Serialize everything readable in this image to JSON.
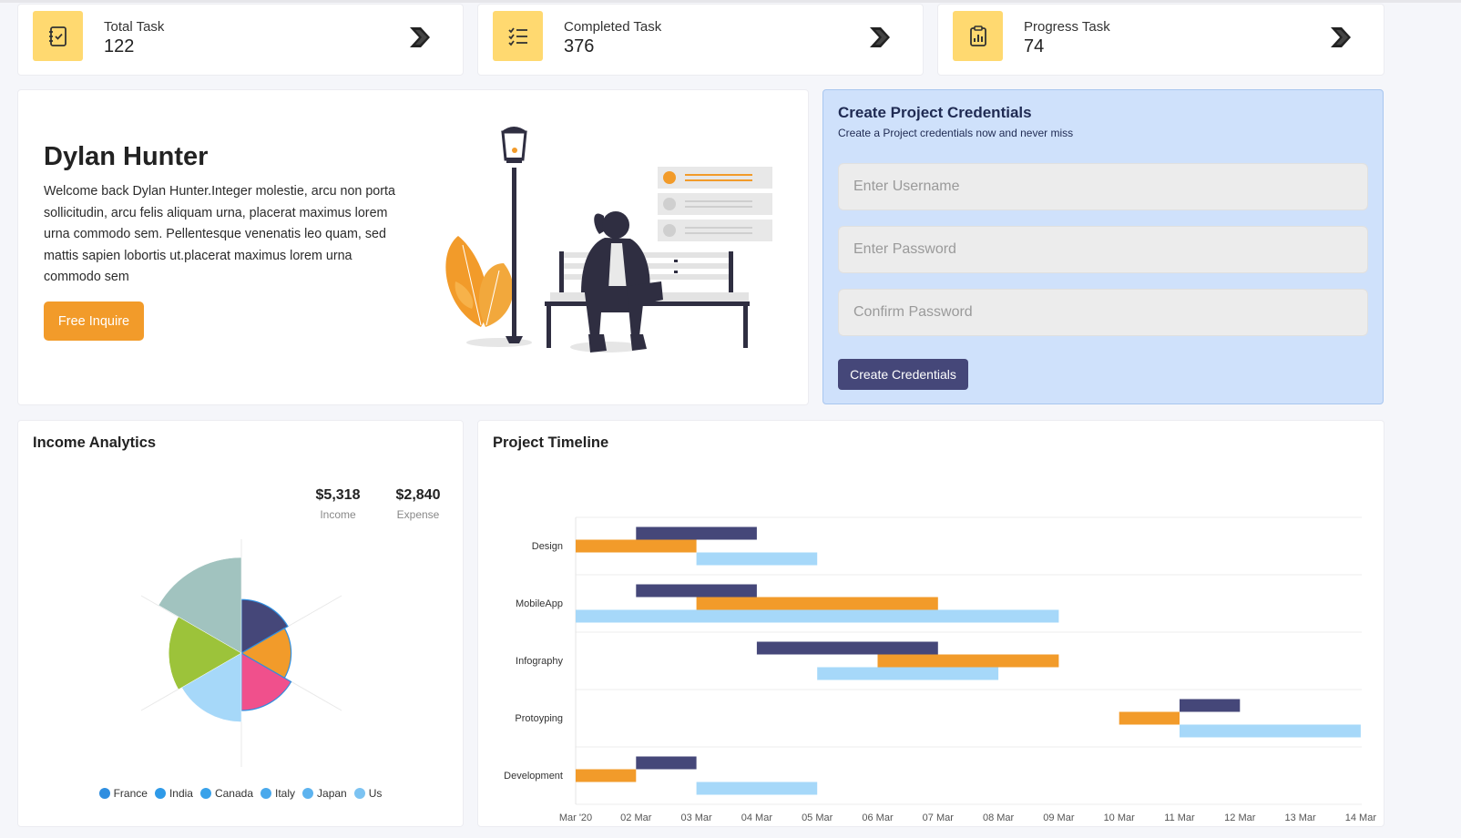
{
  "stats": [
    {
      "label": "Total Task",
      "value": "122",
      "icon": "notebook-check-icon"
    },
    {
      "label": "Completed Task",
      "value": "376",
      "icon": "list-check-icon"
    },
    {
      "label": "Progress Task",
      "value": "74",
      "icon": "clipboard-chart-icon"
    }
  ],
  "welcome": {
    "name": "Dylan Hunter",
    "text": "Welcome back Dylan Hunter.Integer molestie, arcu non porta sollicitudin, arcu felis aliquam urna, placerat maximus lorem urna commodo sem. Pellentesque venenatis leo quam, sed mattis sapien lobortis ut.placerat maximus lorem urna commodo sem",
    "button": "Free Inquire"
  },
  "credentials": {
    "title": "Create Project Credentials",
    "subtitle": "Create a Project credentials now and never miss",
    "username_placeholder": "Enter Username",
    "password_placeholder": "Enter Password",
    "confirm_placeholder": "Confirm Password",
    "button": "Create Credentials"
  },
  "income": {
    "title": "Income Analytics",
    "income_value": "$5,318",
    "income_label": "Income",
    "expense_value": "$2,840",
    "expense_label": "Expense"
  },
  "timeline": {
    "title": "Project Timeline"
  },
  "colors": {
    "accent_yellow": "#ffd970",
    "orange": "#f29b2a",
    "navy": "#454779",
    "light_blue": "#a6d8f9",
    "pink": "#f0508c",
    "green": "#9cc33a",
    "sage": "#a1c3bf"
  },
  "chart_data": [
    {
      "type": "pie",
      "title": "",
      "variant": "polar-area",
      "categories": [
        "France",
        "India",
        "Canada",
        "Italy",
        "Japan",
        "Us"
      ],
      "values": [
        0.7,
        0.65,
        0.75,
        0.9,
        0.95,
        1.25
      ],
      "colors": [
        "#454779",
        "#f29b2a",
        "#f0508c",
        "#a6d8f9",
        "#9cc33a",
        "#a1c3bf"
      ],
      "legend_position": "bottom"
    },
    {
      "type": "bar",
      "variant": "gantt",
      "title": "",
      "categories": [
        "Design",
        "MobileApp",
        "Infography",
        "Protoyping",
        "Development"
      ],
      "x_ticks": [
        "Mar '20",
        "02 Mar",
        "03 Mar",
        "04 Mar",
        "05 Mar",
        "06 Mar",
        "07 Mar",
        "08 Mar",
        "09 Mar",
        "10 Mar",
        "11 Mar",
        "12 Mar",
        "13 Mar",
        "14 Mar"
      ],
      "series": [
        {
          "color": "#454779",
          "ranges": [
            [
              1,
              3
            ],
            [
              1,
              3
            ],
            [
              3,
              6
            ],
            [
              10,
              11
            ],
            [
              1,
              2
            ]
          ]
        },
        {
          "color": "#f29b2a",
          "ranges": [
            [
              0,
              2
            ],
            [
              2,
              6
            ],
            [
              5,
              8
            ],
            [
              9,
              10
            ],
            [
              0,
              1
            ]
          ]
        },
        {
          "color": "#a6d8f9",
          "ranges": [
            [
              2,
              4
            ],
            [
              0,
              8
            ],
            [
              4,
              7
            ],
            [
              10,
              13
            ],
            [
              2,
              4
            ]
          ]
        }
      ],
      "grid": true
    }
  ]
}
